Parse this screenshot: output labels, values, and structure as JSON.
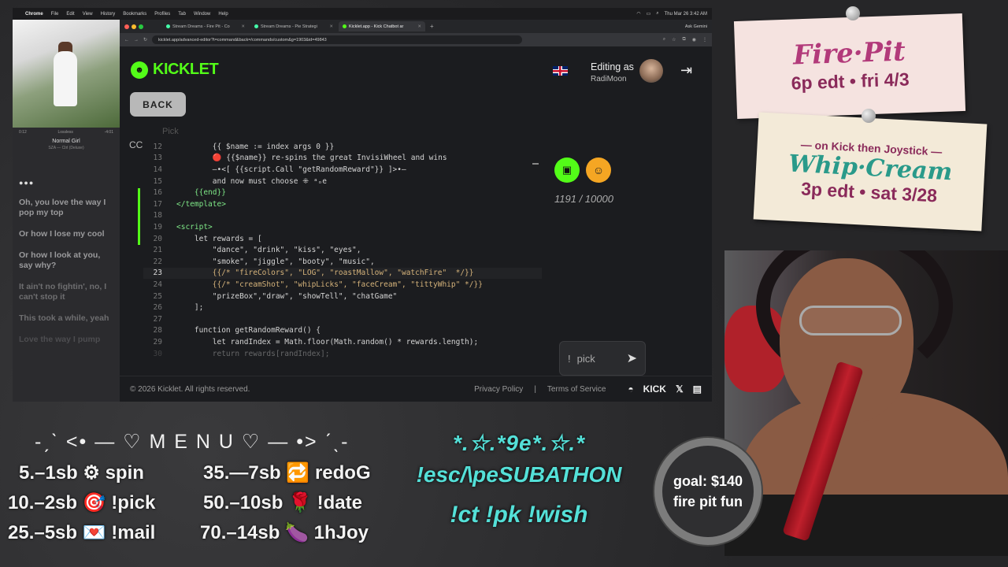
{
  "menubar": {
    "app": "Chrome",
    "items": [
      "File",
      "Edit",
      "View",
      "History",
      "Bookmarks",
      "Profiles",
      "Tab",
      "Window",
      "Help"
    ],
    "clock": "Thu Mar 26  3:42 AM"
  },
  "music": {
    "time_elapsed": "0:12",
    "quality": "Lossless",
    "time_remaining": "-4:01",
    "song": "Normal Girl",
    "artist": "SZA — Ctrl (Deluxe)",
    "lyrics": [
      "Oh, you love the way I pop my top",
      "Or how I lose my cool",
      "Or how I look at you, say why?",
      "It ain't no fightin', no, I can't stop it",
      "This took a while, yeah",
      "Love the way I pump"
    ]
  },
  "browser": {
    "tabs": [
      {
        "label": "Stream Dreams - Fire Pit - Co"
      },
      {
        "label": "Stream Dreams - Pie Strategi"
      },
      {
        "label": "Kicklet.app - Kick Chatbot ar"
      }
    ],
    "gemini": "Ask Gemini",
    "url": "kicklet.app/advanced-editor?t=command&back=/commands/custom&g=1903&id=49843"
  },
  "kicklet": {
    "brand": "KICKLET",
    "editing_label": "Editing as",
    "editing_user": "RadiMoon",
    "back_label": "BACK",
    "editor_tab": "Pick",
    "cc": "CC",
    "counter": "1191 / 10000",
    "chat_input_prefix": "!",
    "chat_input_value": "pick",
    "footer_copyright": "© 2026 Kicklet. All rights reserved.",
    "footer_privacy": "Privacy Policy",
    "footer_sep": "|",
    "footer_terms": "Terms of Service",
    "footer_kick": "KICK"
  },
  "code_lines": [
    {
      "n": "12",
      "t": "        {{ $name := index args 0 }}"
    },
    {
      "n": "13",
      "t": "        🔴 {{$name}} re-spins the great InvisiWheel and wins"
    },
    {
      "n": "14",
      "t": "        —•<[ {{script.Call \"getRandomReward\"}} ]>•—"
    },
    {
      "n": "15",
      "t": "        and now must choose ⁜ ᵃₒe"
    },
    {
      "n": "16",
      "t": "    {{end}}"
    },
    {
      "n": "17",
      "t": "</template>"
    },
    {
      "n": "18",
      "t": ""
    },
    {
      "n": "19",
      "t": "<script>"
    },
    {
      "n": "20",
      "t": "    let rewards = ["
    },
    {
      "n": "21",
      "t": "        \"dance\", \"drink\", \"kiss\", \"eyes\","
    },
    {
      "n": "22",
      "t": "        \"smoke\", \"jiggle\", \"booty\", \"music\","
    },
    {
      "n": "23",
      "t": "        {{/* \"fireColors\", \"LOG\", \"roastMallow\", \"watchFire\"  */}}"
    },
    {
      "n": "24",
      "t": "        {{/* \"creamShot\", \"whipLicks\", \"faceCream\", \"tittyWhip\" */}}"
    },
    {
      "n": "25",
      "t": "        \"prizeBox\",\"draw\", \"showTell\", \"chatGame\""
    },
    {
      "n": "26",
      "t": "    ];"
    },
    {
      "n": "27",
      "t": ""
    },
    {
      "n": "28",
      "t": "    function getRandomReward() {"
    },
    {
      "n": "29",
      "t": "        let randIndex = Math.floor(Math.random() * rewards.length);"
    },
    {
      "n": "30",
      "t": "        return rewards[randIndex];"
    }
  ],
  "notes": {
    "fire_title": "Fire·Pit",
    "fire_time": "6p edt • fri 4/3",
    "whip_pre": "— on Kick then Joystick —",
    "whip_title": "Whip·Cream",
    "whip_time": "3p edt • sat 3/28"
  },
  "overlay_menu": {
    "title": "-ˏˋ <• — ♡ M E N U ♡ — •> ˊˎ-",
    "items": [
      {
        "text": "5.–1sb ⚙ spin"
      },
      {
        "text": "10.–2sb 🎯 !pick"
      },
      {
        "text": "25.–5sb 💌 !mail"
      },
      {
        "text": "35.—7sb 🔁 redoG"
      },
      {
        "text": "50.–10sb 🌹 !date"
      },
      {
        "text": "70.–14sb 🍆 1hJoy"
      }
    ]
  },
  "subathon": {
    "stars": "*.☆.*9e*.☆.*",
    "title": "!esc/\\peSUBATHON",
    "cmds": "!ct !pk !wish"
  },
  "goal": {
    "line1": "goal: $140",
    "line2": "fire pit fun"
  }
}
